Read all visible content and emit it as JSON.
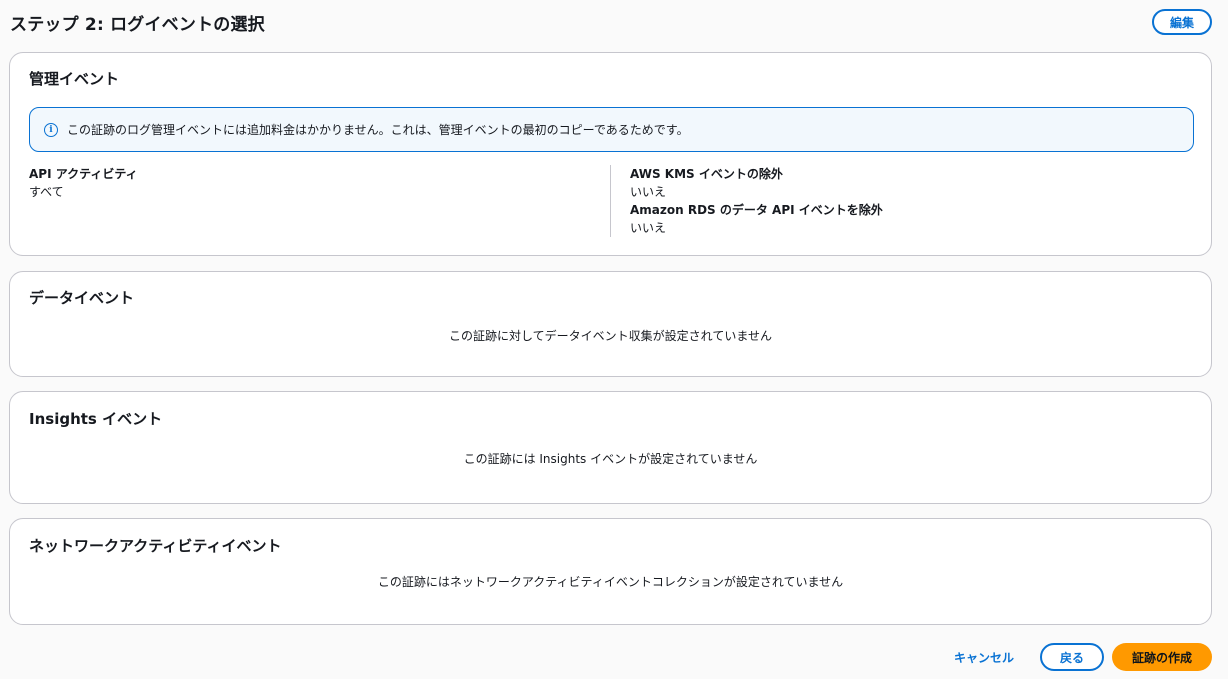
{
  "header": {
    "title": "ステップ 2: ログイベントの選択",
    "edit_label": "編集"
  },
  "management": {
    "title": "管理イベント",
    "alert_text": "この証跡のログ管理イベントには追加料金はかかりません。これは、管理イベントの最初のコピーであるためです。",
    "api_activity_label": "API アクティビティ",
    "api_activity_value": "すべて",
    "kms_label": "AWS KMS イベントの除外",
    "kms_value": "いいえ",
    "rds_label": "Amazon RDS のデータ API イベントを除外",
    "rds_value": "いいえ"
  },
  "data_events": {
    "title": "データイベント",
    "empty_text": "この証跡に対してデータイベント収集が設定されていません"
  },
  "insights": {
    "title": "Insights イベント",
    "empty_text": "この証跡には Insights イベントが設定されていません"
  },
  "network": {
    "title": "ネットワークアクティビティイベント",
    "empty_text": "この証跡にはネットワークアクティビティイベントコレクションが設定されていません"
  },
  "footer": {
    "cancel_label": "キャンセル",
    "back_label": "戻る",
    "create_label": "証跡の作成"
  },
  "colors": {
    "accent": "#0972d3",
    "primary_button": "#ff9900",
    "alert_background": "#f2f8fd"
  },
  "icons": {
    "info": "info-icon"
  }
}
